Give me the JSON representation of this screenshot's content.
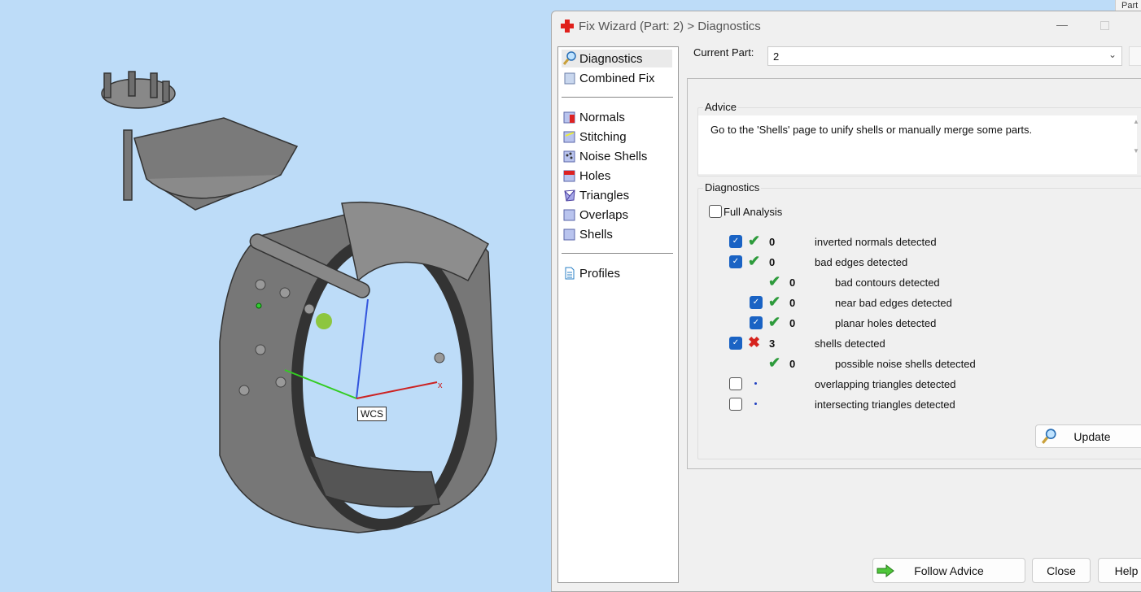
{
  "viewport": {
    "axis_label": "WCS",
    "axis_x": "x"
  },
  "other_window": {
    "label": "Part"
  },
  "dialog": {
    "title": "Fix Wizard (Part: 2) > Diagnostics",
    "nav": {
      "items": [
        {
          "label": "Diagnostics",
          "icon": "magnifier-icon",
          "selected": true
        },
        {
          "label": "Combined Fix",
          "icon": "combined-fix-icon"
        },
        {
          "label": "Normals",
          "icon": "normals-cube-icon"
        },
        {
          "label": "Stitching",
          "icon": "stitching-cube-icon"
        },
        {
          "label": "Noise Shells",
          "icon": "noise-shells-cube-icon"
        },
        {
          "label": "Holes",
          "icon": "holes-cube-icon"
        },
        {
          "label": "Triangles",
          "icon": "triangles-cube-icon"
        },
        {
          "label": "Overlaps",
          "icon": "overlaps-cube-icon"
        },
        {
          "label": "Shells",
          "icon": "shells-cube-icon"
        },
        {
          "label": "Profiles",
          "icon": "document-icon"
        }
      ]
    },
    "current_part": {
      "label": "Current Part:",
      "value": "2"
    },
    "advice": {
      "title": "Advice",
      "text": "Go to the 'Shells' page to unify shells or manually merge some parts."
    },
    "diagnostics": {
      "title": "Diagnostics",
      "full_analysis": {
        "label": "Full Analysis",
        "checked": false
      },
      "rows": [
        {
          "checked": true,
          "status": "ok",
          "count": "0",
          "label": "inverted normals detected",
          "indent": 0
        },
        {
          "checked": true,
          "status": "ok",
          "count": "0",
          "label": "bad edges detected",
          "indent": 0
        },
        {
          "checked": null,
          "status": "ok",
          "count": "0",
          "label": "bad contours detected",
          "indent": 1
        },
        {
          "checked": true,
          "status": "ok",
          "count": "0",
          "label": "near bad edges detected",
          "indent": 1
        },
        {
          "checked": true,
          "status": "ok",
          "count": "0",
          "label": "planar holes detected",
          "indent": 1
        },
        {
          "checked": true,
          "status": "bad",
          "count": "3",
          "label": "shells detected",
          "indent": 0
        },
        {
          "checked": null,
          "status": "ok",
          "count": "0",
          "label": "possible noise shells detected",
          "indent": 1
        },
        {
          "checked": false,
          "status": "pending",
          "count": "",
          "label": "overlapping triangles detected",
          "indent": 0
        },
        {
          "checked": false,
          "status": "pending",
          "count": "",
          "label": "intersecting triangles detected",
          "indent": 0
        }
      ],
      "update_label": "Update"
    },
    "buttons": {
      "follow_advice": "Follow Advice",
      "close": "Close",
      "help": "Help"
    }
  },
  "colors": {
    "background": "#bddcf8",
    "ok": "#2e9b3c",
    "bad": "#d6231e",
    "checkbox": "#1a63c4"
  }
}
